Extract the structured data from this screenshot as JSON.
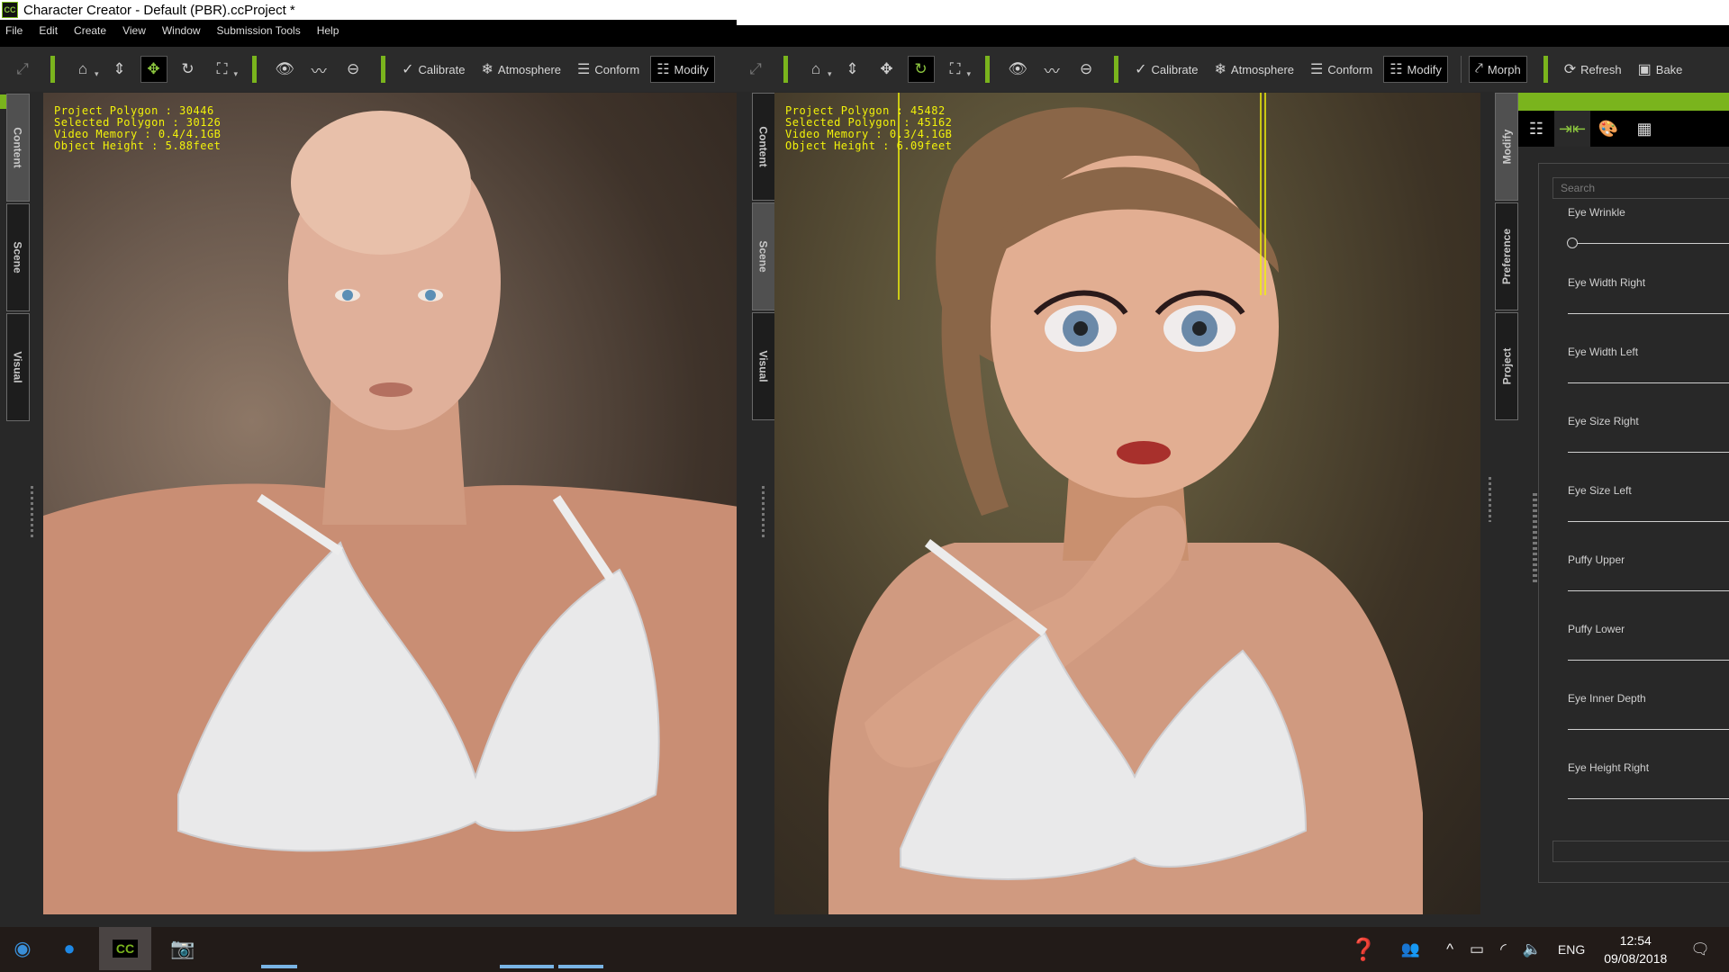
{
  "left_window": {
    "title": "Character Creator - Default (PBR).ccProject *",
    "app_icon": "character-creator-logo",
    "menu": [
      "File",
      "Edit",
      "Create",
      "View",
      "Window",
      "Submission Tools",
      "Help"
    ],
    "toolbar": {
      "buttons": [
        {
          "label": "Calibrate",
          "icon": "calibrate-icon"
        },
        {
          "label": "Atmosphere",
          "icon": "atmosphere-icon"
        },
        {
          "label": "Conform",
          "icon": "conform-icon"
        },
        {
          "label": "Modify",
          "icon": "modify-sliders-icon"
        }
      ]
    },
    "side_tabs": [
      {
        "label": "Content",
        "active": true
      },
      {
        "label": "Scene",
        "active": false
      },
      {
        "label": "Visual",
        "active": false
      }
    ],
    "hud": {
      "project_polygon": "Project Polygon : 30446",
      "selected_polygon": "Selected Polygon : 30126",
      "video_memory": "Video Memory : 0.4/4.1GB",
      "object_height": "Object Height : 5.88feet"
    }
  },
  "right_window": {
    "toolbar": {
      "buttons": [
        {
          "label": "Calibrate",
          "icon": "calibrate-icon"
        },
        {
          "label": "Atmosphere",
          "icon": "atmosphere-icon"
        },
        {
          "label": "Conform",
          "icon": "conform-icon"
        },
        {
          "label": "Modify",
          "icon": "modify-sliders-icon"
        },
        {
          "label": "Morph",
          "icon": "morph-icon"
        },
        {
          "label": "Refresh",
          "icon": "refresh-icon"
        },
        {
          "label": "Bake",
          "icon": "bake-icon"
        }
      ]
    },
    "left_side_tabs": [
      {
        "label": "Content",
        "active": false
      },
      {
        "label": "Scene",
        "active": true
      },
      {
        "label": "Visual",
        "active": false
      }
    ],
    "right_side_tabs": [
      {
        "label": "Modify",
        "active": true
      },
      {
        "label": "Preference",
        "active": false
      },
      {
        "label": "Project",
        "active": false
      }
    ],
    "hud": {
      "project_polygon": "Project Polygon : 45482",
      "selected_polygon": "Selected Polygon : 45162",
      "video_memory": "Video Memory : 0.3/4.1GB",
      "object_height": "Object Height : 6.09feet"
    },
    "modify_panel": {
      "tabs": [
        "modify-sliders-icon",
        "morph-adjust-icon",
        "appearance-palette-icon",
        "texture-checker-icon"
      ],
      "active_tab": 1,
      "search_placeholder": "Search",
      "sliders": [
        {
          "label": "Eye Wrinkle",
          "value": 0,
          "show_knob": true
        },
        {
          "label": "Eye Width Right"
        },
        {
          "label": "Eye Width Left"
        },
        {
          "label": "Eye Size Right"
        },
        {
          "label": "Eye Size Left"
        },
        {
          "label": "Puffy Upper"
        },
        {
          "label": "Puffy Lower"
        },
        {
          "label": "Eye Inner Depth"
        },
        {
          "label": "Eye Height Right"
        }
      ]
    }
  },
  "taskbar": {
    "apps": [
      "thunderbird",
      "edge-browser",
      "character-creator",
      "camera"
    ],
    "tray": {
      "language": "ENG",
      "time": "12:54",
      "date": "09/08/2018"
    }
  },
  "colors": {
    "accent_green": "#7ab41d",
    "hud_yellow": "#f2f20a",
    "panel_bg": "#282828"
  }
}
